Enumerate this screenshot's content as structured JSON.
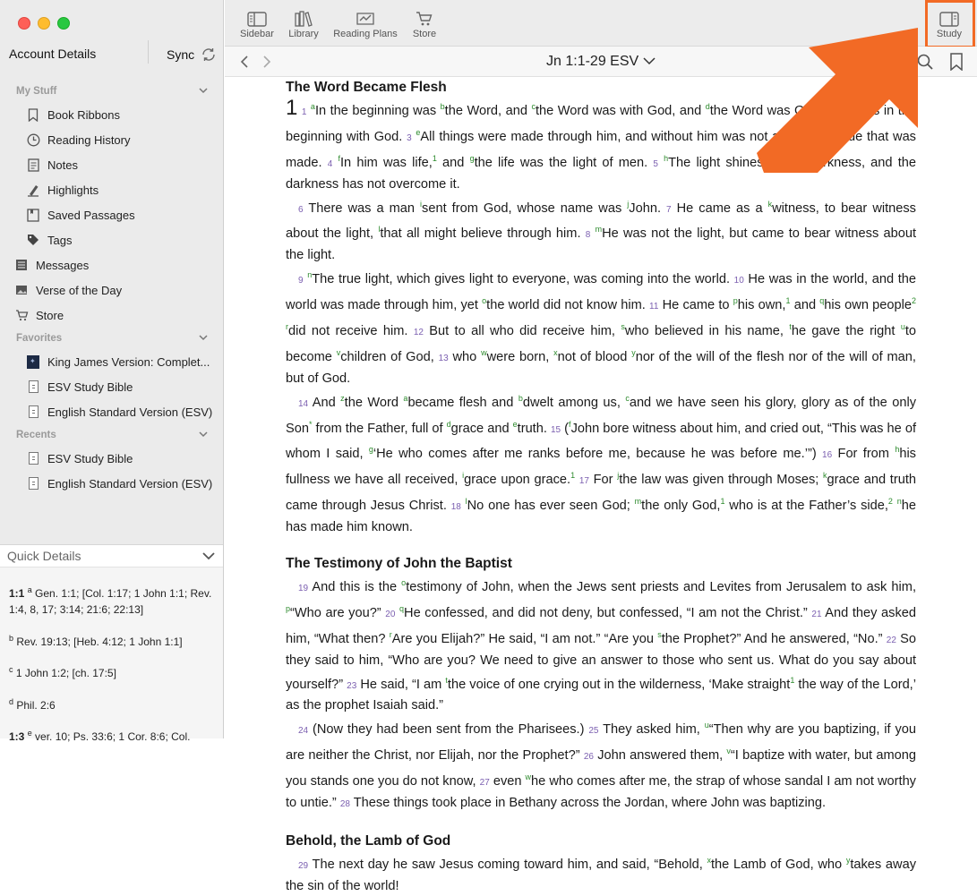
{
  "sidebar": {
    "account": "Account Details",
    "sync": "Sync",
    "my_stuff": {
      "heading": "My Stuff",
      "items": [
        "Book Ribbons",
        "Reading History",
        "Notes",
        "Highlights",
        "Saved Passages",
        "Tags"
      ]
    },
    "top_items": [
      "Messages",
      "Verse of the Day",
      "Store"
    ],
    "favorites": {
      "heading": "Favorites",
      "items": [
        "King James Version: Complet...",
        "ESV Study Bible",
        "English Standard Version (ESV)"
      ]
    },
    "recents": {
      "heading": "Recents",
      "items": [
        "ESV Study Bible",
        "English Standard Version (ESV)"
      ]
    }
  },
  "quick_details": {
    "title": "Quick Details",
    "entries": [
      {
        "ref": "1:1",
        "letter": "a",
        "text": "Gen. 1:1; [Col. 1:17; 1 John 1:1; Rev. 1:4, 8, 17; 3:14; 21:6; 22:13]"
      },
      {
        "ref": "",
        "letter": "b",
        "text": "Rev. 19:13; [Heb. 4:12; 1 John 1:1]"
      },
      {
        "ref": "",
        "letter": "c",
        "text": "1 John 1:2; [ch. 17:5]"
      },
      {
        "ref": "",
        "letter": "d",
        "text": "Phil. 2:6"
      },
      {
        "ref": "1:3",
        "letter": "e",
        "text": "ver. 10; Ps. 33:6; 1 Cor. 8:6; Col."
      }
    ]
  },
  "toolbar": {
    "sidebar": "Sidebar",
    "library": "Library",
    "reading_plans": "Reading Plans",
    "store": "Store",
    "study": "Study"
  },
  "nav": {
    "reference": "Jn 1:1-29",
    "version": "ESV"
  },
  "text": {
    "heading1": "The Word Became Flesh",
    "heading2": "The Testimony of John the Baptist",
    "heading3": "Behold, the Lamb of God"
  },
  "colors": {
    "accent_arrow": "#f26a25",
    "verse_number": "#7b5fb0",
    "footnote": "#2c8a2c"
  }
}
